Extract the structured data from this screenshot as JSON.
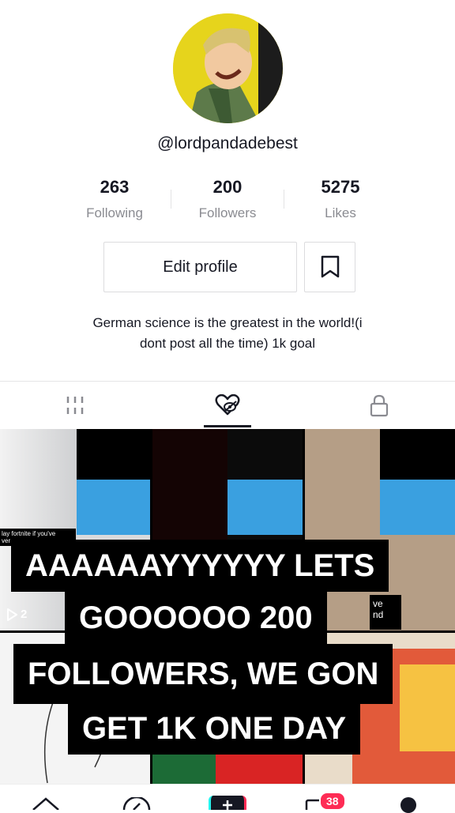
{
  "profile": {
    "username": "@lordpandadebest",
    "stats": [
      {
        "value": "263",
        "label": "Following"
      },
      {
        "value": "200",
        "label": "Followers"
      },
      {
        "value": "5275",
        "label": "Likes"
      }
    ],
    "edit_label": "Edit profile",
    "bio_line1": "German science is the greatest in the world!(i",
    "bio_line2": "dont post all the time) 1k goal"
  },
  "tabs": [
    {
      "icon": "grid-icon",
      "active": false
    },
    {
      "icon": "liked-videos-icon",
      "active": true
    },
    {
      "icon": "lock-icon",
      "active": false
    }
  ],
  "grid": {
    "first_play_count": "2",
    "snippet_left": "lay fortnite if you've",
    "snippet_left2": "ver",
    "snippet_right": "ve",
    "snippet_right2": "nd"
  },
  "overlay_caption": {
    "line1": "AAAAAAYYYYYY LETS",
    "line2": "GOOOOOO 200",
    "line3": "FOLLOWERS, WE GON",
    "line4": "GET 1K ONE DAY"
  },
  "nav": {
    "inbox_badge": "38"
  },
  "colors": {
    "accent": "#fe2c55",
    "text": "#161823",
    "muted": "#8a8b91"
  }
}
